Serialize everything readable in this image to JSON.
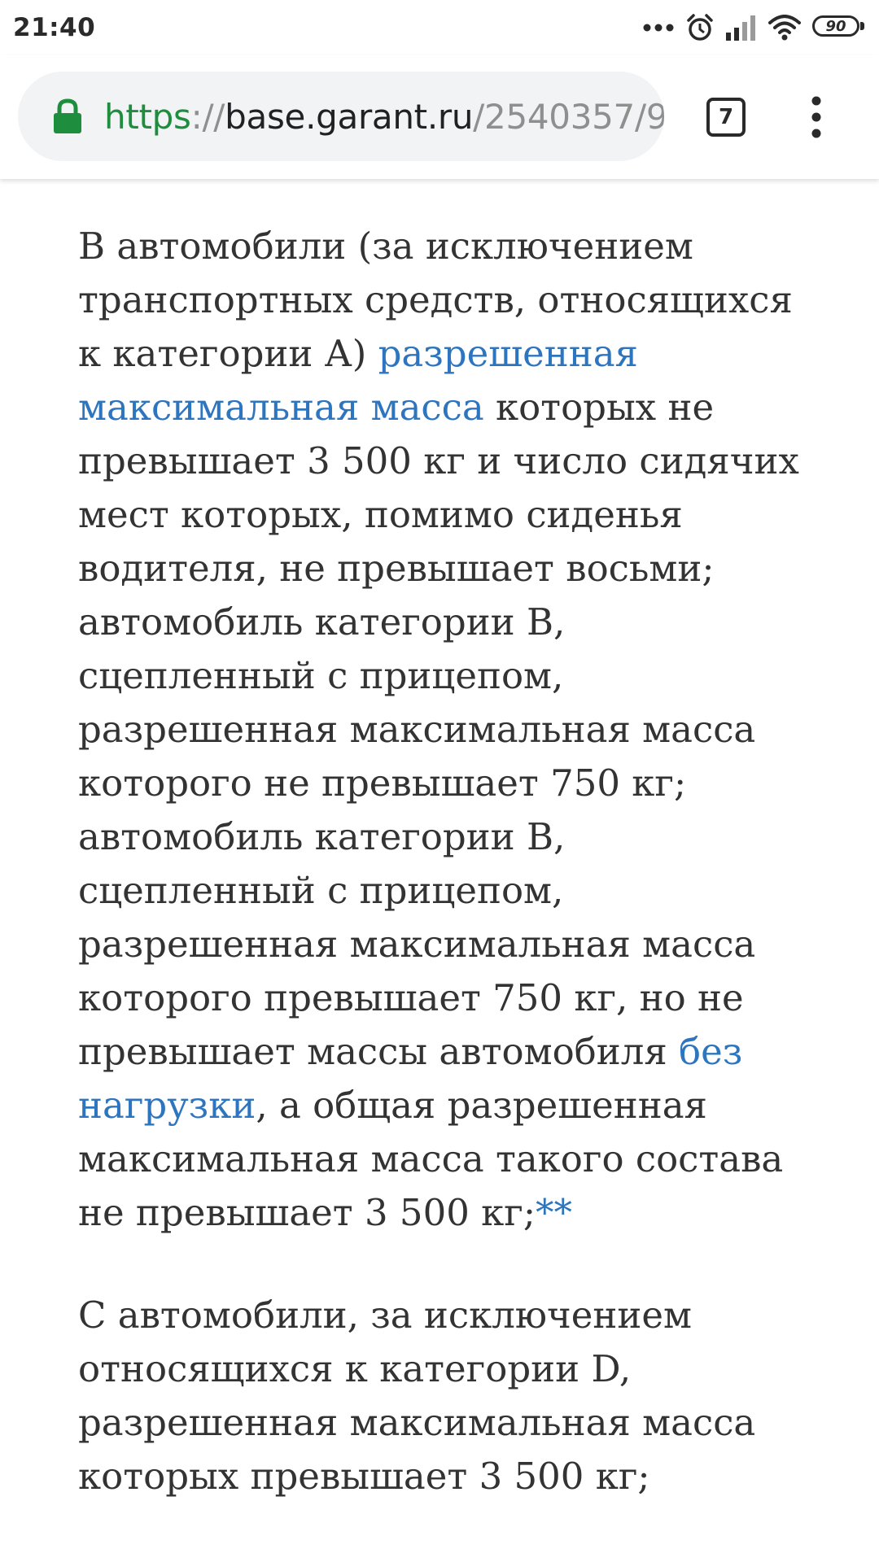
{
  "status_bar": {
    "time": "21:40",
    "battery": "90",
    "icons": [
      "more-dots-icon",
      "alarm-icon",
      "signal-icon",
      "wifi-icon",
      "battery-icon"
    ]
  },
  "browser": {
    "url": {
      "scheme": "https",
      "separator": "://",
      "host": "base.garant.ru",
      "path": "/2540357/9"
    },
    "tab_count": "7",
    "colors": {
      "url_scheme": "#1e8e3e",
      "lock": "#1e8e3e",
      "link": "#2d75be"
    }
  },
  "article": {
    "paragraph_b": {
      "text_1": "В автомобили (за исключением транспортных средств, относящихся к категории А) ",
      "link_1": "разрешенная максимальная масса",
      "text_2": " которых не превышает 3 500 кг и число сидячих мест которых, помимо сиденья водителя, не превышает восьми; автомобиль категории В, сцепленный с прицепом, разрешенная максимальная масса которого не превышает 750 кг; автомобиль категории В, сцепленный с прицепом, разрешенная максимальная масса которого превышает 750 кг, но не превышает массы автомобиля ",
      "link_2": "без нагрузки",
      "text_3": ", а общая разрешенная максимальная масса такого состава не превышает 3 500 кг;",
      "footnote": "**"
    },
    "paragraph_c": {
      "text_1": "С автомобили, за исключением относящихся к категории D, разрешенная максимальная масса которых превышает 3 500 кг;"
    }
  }
}
